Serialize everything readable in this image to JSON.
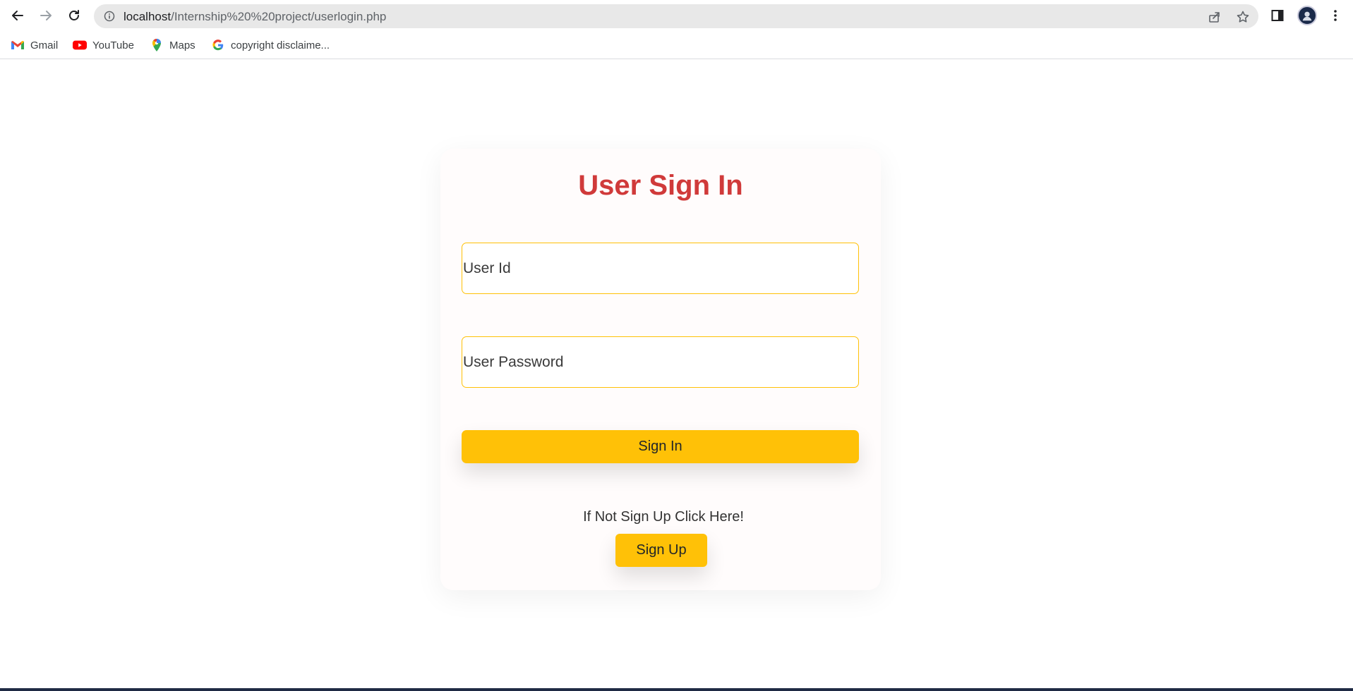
{
  "browser": {
    "url_host": "localhost",
    "url_path": "/Internship%20%20project/userlogin.php",
    "bookmarks": [
      {
        "label": "Gmail",
        "icon": "gmail-icon"
      },
      {
        "label": "YouTube",
        "icon": "youtube-icon"
      },
      {
        "label": "Maps",
        "icon": "maps-icon"
      },
      {
        "label": "copyright disclaime...",
        "icon": "google-icon"
      }
    ]
  },
  "login": {
    "title": "User Sign In",
    "userid_placeholder": "User Id",
    "password_placeholder": "User Password",
    "signin_label": "Sign In",
    "signup_prompt": "If Not Sign Up Click Here!",
    "signup_label": "Sign Up"
  },
  "colors": {
    "title": "#d03a3a",
    "accent": "#ffc107",
    "card_bg": "#fffcfc"
  }
}
